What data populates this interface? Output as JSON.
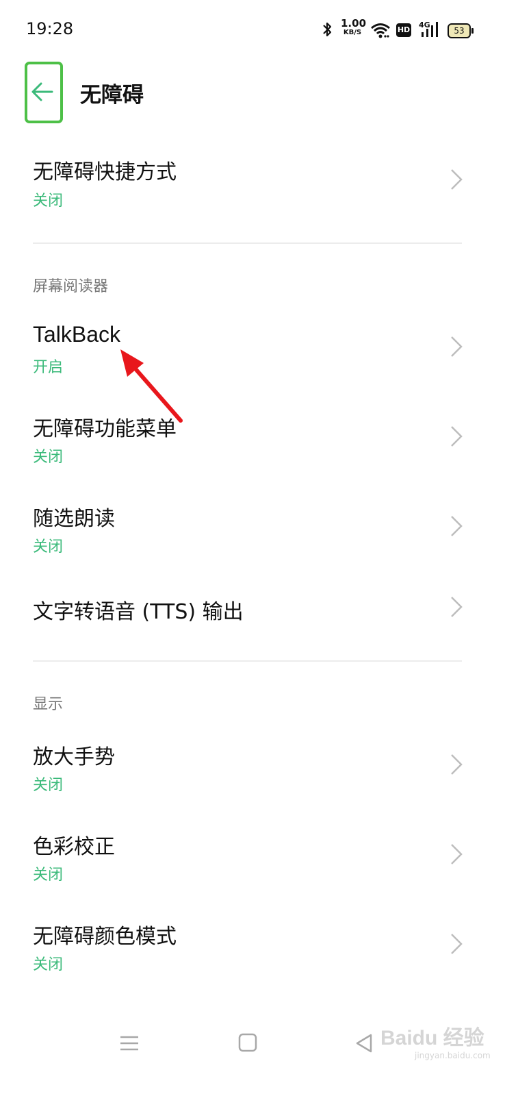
{
  "status_bar": {
    "time": "19:28",
    "net_speed_value": "1.00",
    "net_speed_unit": "KB/S",
    "hd_label": "HD",
    "network_type": "4G",
    "battery_level": "53"
  },
  "header": {
    "title": "无障碍"
  },
  "items": [
    {
      "title": "无障碍快捷方式",
      "status": "关闭"
    },
    {
      "title": "TalkBack",
      "status": "开启"
    },
    {
      "title": "无障碍功能菜单",
      "status": "关闭"
    },
    {
      "title": "随选朗读",
      "status": "关闭"
    },
    {
      "title": "文字转语音 (TTS) 输出"
    },
    {
      "title": "放大手势",
      "status": "关闭"
    },
    {
      "title": "色彩校正",
      "status": "关闭"
    },
    {
      "title": "无障碍颜色模式",
      "status": "关闭"
    }
  ],
  "sections": {
    "screen_reader": "屏幕阅读器",
    "display": "显示"
  },
  "watermark": {
    "text": "Baidu 经验",
    "url": "jingyan.baidu.com"
  },
  "colors": {
    "accent_green": "#3bba7a",
    "highlight_box": "#4dc047",
    "annotation_arrow": "#e8171c"
  }
}
